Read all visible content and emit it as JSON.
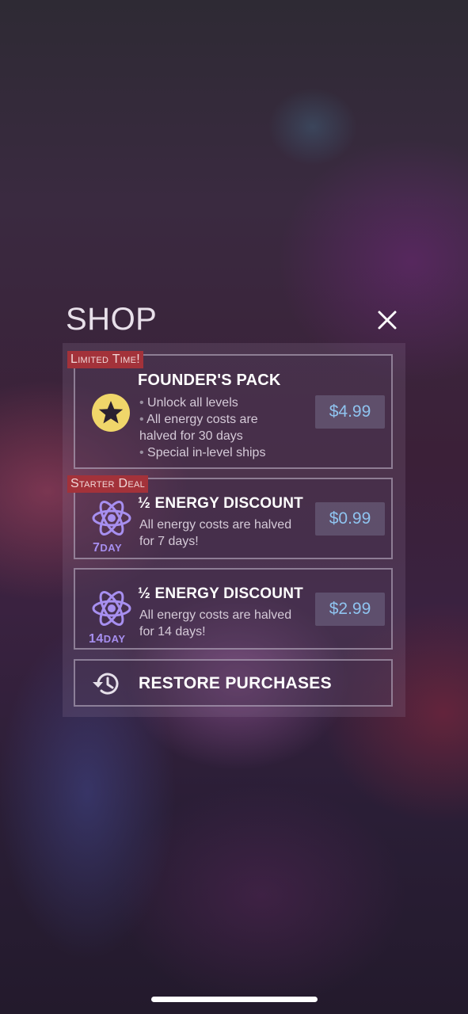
{
  "shop": {
    "title": "SHOP"
  },
  "items": [
    {
      "ribbon": "Limited Time!",
      "title": "FOUNDER'S PACK",
      "bullets": [
        "Unlock all levels",
        "All energy costs are",
        "halved for 30 days",
        "Special in-level ships"
      ],
      "price": "$4.99",
      "icon": "star-icon"
    },
    {
      "ribbon": "Starter Deal",
      "title": "½ ENERGY DISCOUNT",
      "desc_line1": "All energy costs are halved",
      "desc_line2": "for 7 days!",
      "price": "$0.99",
      "icon": "atom-icon",
      "day_num": "7",
      "day_unit": "DAY"
    },
    {
      "title": "½ ENERGY DISCOUNT",
      "desc_line1": "All energy costs are halved",
      "desc_line2": "for 14 days!",
      "price": "$2.99",
      "icon": "atom-icon",
      "day_num": "14",
      "day_unit": "DAY"
    }
  ],
  "restore": {
    "label": "RESTORE PURCHASES",
    "icon": "history-icon"
  },
  "colors": {
    "accent_price": "#8fc4f0",
    "ribbon": "#a3323a",
    "atom": "#a78ff0",
    "star_badge": "#f0d66a"
  }
}
